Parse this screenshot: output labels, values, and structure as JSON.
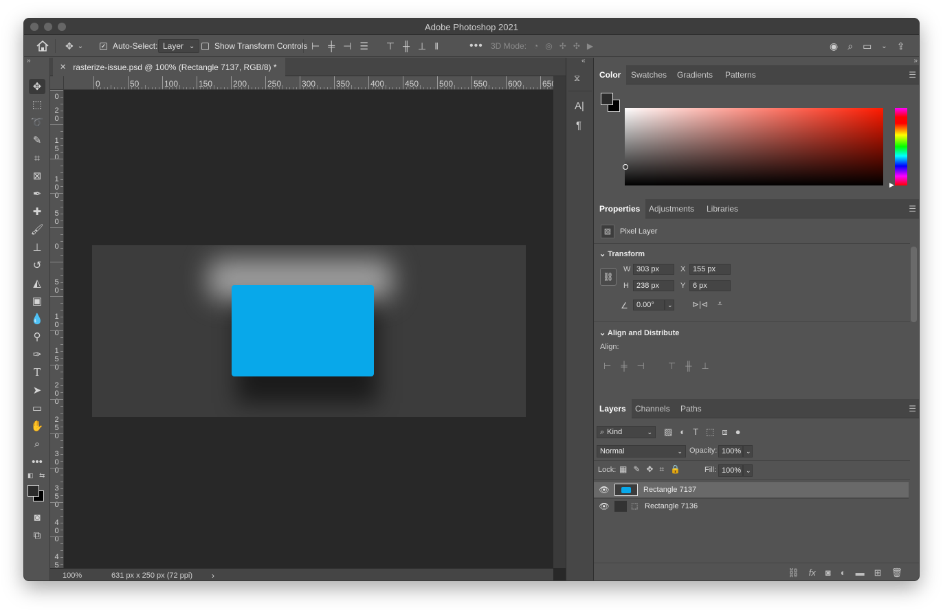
{
  "window": {
    "title": "Adobe Photoshop 2021"
  },
  "options_bar": {
    "auto_select_label": "Auto-Select:",
    "auto_select_value": "Layer",
    "show_transform_label": "Show Transform Controls",
    "three_d_mode_label": "3D Mode:"
  },
  "document": {
    "tab_title": "rasterize-issue.psd @ 100% (Rectangle 7137, RGB/8) *",
    "ruler_h_labels": [
      "0",
      "50",
      "100",
      "150",
      "200",
      "250",
      "300",
      "350",
      "400",
      "450",
      "500",
      "550",
      "600",
      "650"
    ],
    "ruler_v_labels": [
      "0",
      "2\n0",
      "1\n5\n0",
      "1\n0\n0",
      "5\n0",
      "0",
      "5\n0",
      "1\n0\n0",
      "1\n5\n0",
      "2\n0\n0",
      "2\n5\n0",
      "3\n0\n0",
      "3\n5\n0",
      "4\n0\n0",
      "4\n5"
    ],
    "zoom": "100%",
    "doc_info": "631 px x 250 px (72 ppi)",
    "fill_color": "#08a8ea"
  },
  "color_panel": {
    "tabs": [
      "Color",
      "Swatches",
      "Gradients",
      "Patterns"
    ]
  },
  "properties_panel": {
    "tabs": [
      "Properties",
      "Adjustments",
      "Libraries"
    ],
    "layer_type": "Pixel Layer",
    "transform_section": "Transform",
    "w_label": "W",
    "w_value": "303 px",
    "h_label": "H",
    "h_value": "238 px",
    "x_label": "X",
    "x_value": "155 px",
    "y_label": "Y",
    "y_value": "6 px",
    "angle_value": "0.00°",
    "align_section": "Align and Distribute",
    "align_label": "Align:"
  },
  "layers_panel": {
    "tabs": [
      "Layers",
      "Channels",
      "Paths"
    ],
    "filter_kind": "Kind",
    "blend_mode": "Normal",
    "opacity_label": "Opacity:",
    "opacity_value": "100%",
    "lock_label": "Lock:",
    "fill_label": "Fill:",
    "fill_value": "100%",
    "layers": [
      {
        "name": "Rectangle 7137",
        "selected": true
      },
      {
        "name": "Rectangle 7136",
        "selected": false
      }
    ]
  }
}
